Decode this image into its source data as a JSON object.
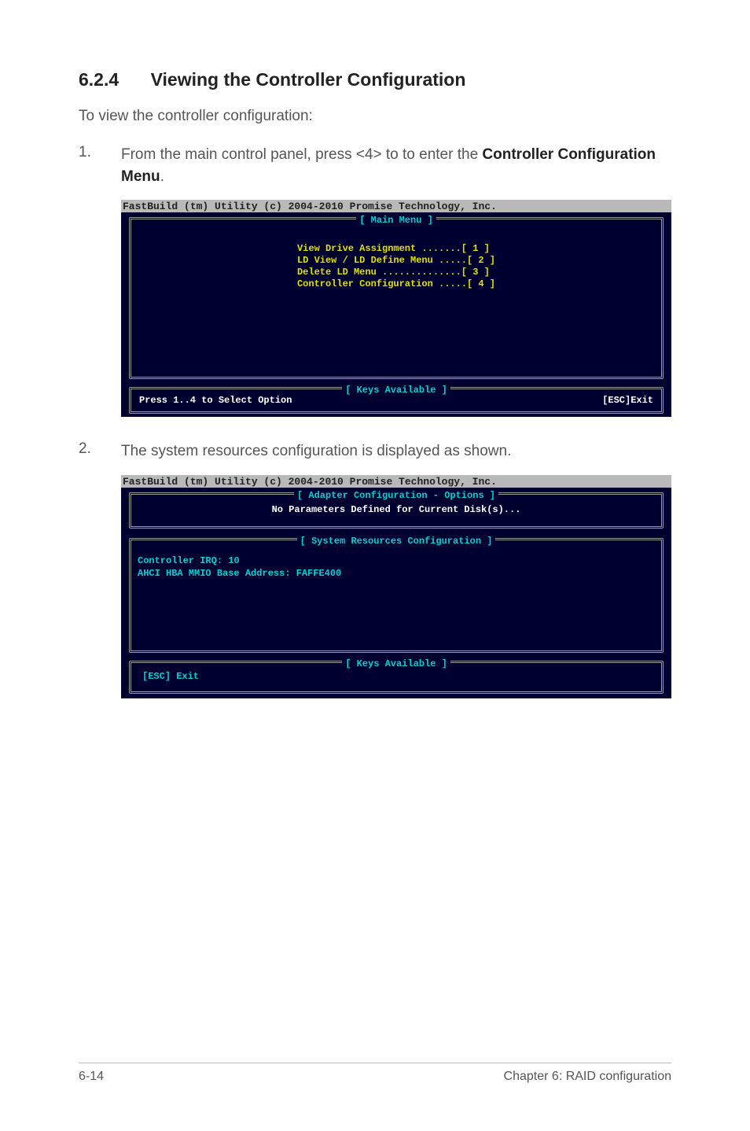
{
  "section": {
    "number": "6.2.4",
    "title": "Viewing the Controller Configuration"
  },
  "intro": "To view the controller configuration:",
  "steps": {
    "s1": {
      "num": "1.",
      "pre": "From the main control panel, press <4> to to enter the ",
      "bold": "Controller Configuration Menu",
      "post": "."
    },
    "s2": {
      "num": "2.",
      "text": "The system resources configuration is displayed as shown."
    }
  },
  "terminal1": {
    "header": "FastBuild (tm) Utility (c) 2004-2010 Promise Technology, Inc.",
    "main_title": "[ Main Menu ]",
    "menu_text": "View Drive Assignment .......[ 1 ]\nLD View / LD Define Menu .....[ 2 ]\nDelete LD Menu ..............[ 3 ]\nController Configuration .....[ 4 ]",
    "keys_title": "[ Keys Available ]",
    "keys_left": "Press 1..4 to Select Option",
    "keys_right": "[ESC]Exit"
  },
  "terminal2": {
    "header": "FastBuild (tm) Utility (c) 2004-2010 Promise Technology, Inc.",
    "opt_title": "[ Adapter Configuration - Options ]",
    "opt_text": "No Parameters Defined for Current Disk(s)...",
    "sys_title": "[ System Resources Configuration ]",
    "sys_text": "Controller IRQ: 10\nAHCI HBA MMIO Base Address: FAFFE400",
    "keys_title": "[ Keys Available ]",
    "keys_text": "[ESC] Exit"
  },
  "footer": {
    "left": "6-14",
    "right": "Chapter 6: RAID configuration"
  }
}
